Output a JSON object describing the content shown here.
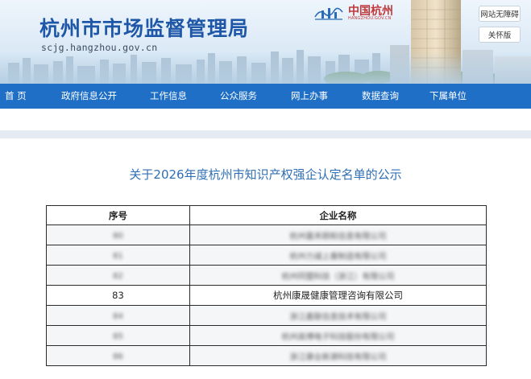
{
  "site": {
    "title": "杭州市市场监督管理局",
    "domain": "scjg.hangzhou.gov.cn",
    "logo_name": "中国杭州",
    "logo_domain": "HANGZHOU.GOV.CN"
  },
  "util": {
    "accessibility": "网站无障碍",
    "care_mode": "关怀版"
  },
  "nav": {
    "items": [
      {
        "label": "首 页"
      },
      {
        "label": "政府信息公开"
      },
      {
        "label": "工作信息"
      },
      {
        "label": "公众服务"
      },
      {
        "label": "网上办事"
      },
      {
        "label": "数据查询"
      },
      {
        "label": "下属单位"
      }
    ]
  },
  "notice": {
    "title": "关于2026年度杭州市知识产权强企认定名单的公示"
  },
  "table": {
    "headers": [
      "序号",
      "企业名称"
    ],
    "rows": [
      {
        "no": "80",
        "name": "杭州嘉禾颐和信息有限公司",
        "blurred": true
      },
      {
        "no": "81",
        "name": "杭州力诚上善制造有限公司",
        "blurred": true
      },
      {
        "no": "82",
        "name": "杭州同盟科技（浙江）有限公司",
        "blurred": true
      },
      {
        "no": "83",
        "name": "杭州康晟健康管理咨询有限公司",
        "blurred": false
      },
      {
        "no": "84",
        "name": "浙江鑫联信息技术有限公司",
        "blurred": true
      },
      {
        "no": "85",
        "name": "杭州高博电子科技股份有限公司",
        "blurred": true
      },
      {
        "no": "86",
        "name": "浙江康业新源科技有限公司",
        "blurred": true
      }
    ]
  },
  "colors": {
    "nav_bg": "#1e6fc5",
    "title_blue": "#1f57a8",
    "notice_blue": "#2f6fb5",
    "logo_red": "#c0393b"
  }
}
